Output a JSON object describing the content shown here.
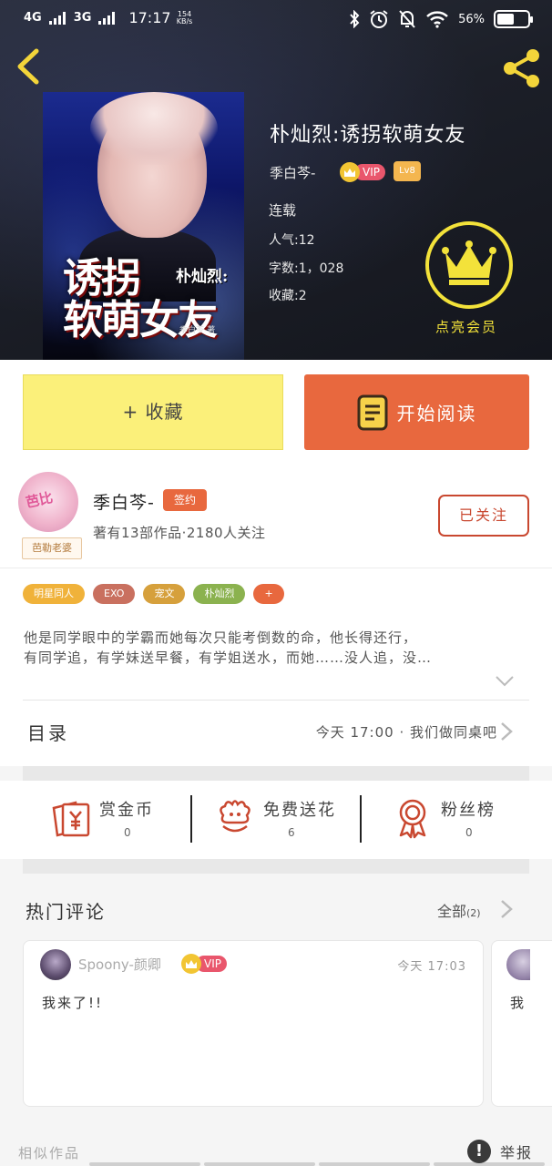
{
  "status_bar": {
    "network_1": "4G",
    "network_2": "3G",
    "time": "17:17",
    "speed_value": "154",
    "speed_unit": "KB/s",
    "battery": "56%",
    "battery_level": 0.56
  },
  "book": {
    "title": "朴灿烈:诱拐软萌女友",
    "author": "季白芩-",
    "vip_label": "VIP",
    "level": "Lv8",
    "status": "连载",
    "popularity": "人气:12",
    "word_count": "字数:1，028",
    "favorites": "收藏:2",
    "member_label": "点亮会员",
    "cover": {
      "title_line1": "诱拐",
      "title_line2": "软萌女友",
      "subtitle": "朴灿烈:",
      "author": "季白芩-著"
    }
  },
  "actions": {
    "collect_label": "+ 收藏",
    "read_label": "开始阅读"
  },
  "author_card": {
    "name": "季白芩-",
    "sign_badge": "签约",
    "info": "著有13部作品·2180人关注",
    "follow_label": "已关注",
    "avatar_tag": "芭勒老婆",
    "avatar_text": "芭比"
  },
  "tags": [
    {
      "label": "明星同人",
      "color": "#f0b23a"
    },
    {
      "label": "EXO",
      "color": "#c9705f"
    },
    {
      "label": "宠文",
      "color": "#d6a03c"
    },
    {
      "label": "朴灿烈",
      "color": "#8bb24f"
    },
    {
      "label": "+",
      "color": "#e8683e"
    }
  ],
  "description": {
    "line1": "他是同学眼中的学霸而她每次只能考倒数的命，他长得还行，",
    "line2": "有同学追，有学妹送早餐，有学姐送水，而她……没人追，没…"
  },
  "catalog": {
    "title": "目录",
    "latest": "今天 17:00 · 我们做同桌吧"
  },
  "stats": [
    {
      "label": "赏金币",
      "value": "0"
    },
    {
      "label": "免费送花",
      "value": "6"
    },
    {
      "label": "粉丝榜",
      "value": "0"
    }
  ],
  "comments": {
    "title": "热门评论",
    "all_label": "全部",
    "all_count": "(2)",
    "items": [
      {
        "user": "Spoony-颜卿",
        "vip": "VIP",
        "time": "今天 17:03",
        "text": "我来了!!"
      }
    ],
    "peek_text": "我"
  },
  "bottom": {
    "similar": "相似作品",
    "report_icon": "!",
    "report_label": "举报"
  },
  "colors": {
    "accent_orange": "#e8683e",
    "collect_yellow": "#fbf07a",
    "member_yellow": "#f3e23a",
    "share_yellow": "#f3d53a",
    "icon_red": "#c94830"
  },
  "icons": {
    "back": "back-arrow-icon",
    "share": "share-icon",
    "crown": "crown-icon",
    "book": "book-icon",
    "gift_coin": "coin-gift-icon",
    "flower": "flower-icon",
    "medal": "medal-icon",
    "chevron": "chevron-right-icon",
    "report": "alert-icon"
  }
}
